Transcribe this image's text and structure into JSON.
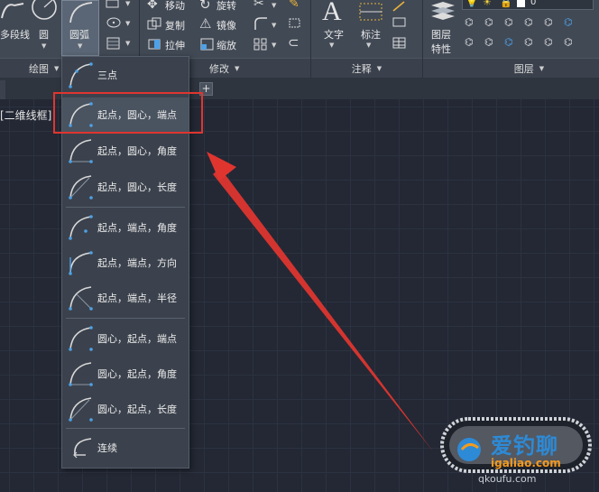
{
  "ribbon": {
    "draw_panel": {
      "title": "绘图",
      "polyline_label": "多段线",
      "circle_label": "圆",
      "arc_label": "圆弧"
    },
    "modify_panel": {
      "title": "修改",
      "move_label": "移动",
      "rotate_label": "旋转",
      "copy_label": "复制",
      "mirror_label": "镜像",
      "stretch_label": "拉伸",
      "scale_label": "缩放"
    },
    "annotation_panel": {
      "title": "注释",
      "text_label": "文字",
      "dimension_label": "标注"
    },
    "layers_panel": {
      "title": "图层",
      "properties_label_1": "图层",
      "properties_label_2": "特性",
      "current_layer": "0"
    }
  },
  "viewport": {
    "label": "[二维线框]"
  },
  "arc_menu": {
    "items": [
      {
        "label": "三点"
      },
      {
        "label": "起点，圆心，端点"
      },
      {
        "label": "起点，圆心，角度"
      },
      {
        "label": "起点，圆心，长度"
      },
      {
        "label": "起点，端点，角度"
      },
      {
        "label": "起点，端点，方向"
      },
      {
        "label": "起点，端点，半径"
      },
      {
        "label": "圆心，起点，端点"
      },
      {
        "label": "圆心，起点，角度"
      },
      {
        "label": "圆心，起点，长度"
      },
      {
        "label": "连续"
      }
    ]
  },
  "watermark": {
    "text": "爱钓聊",
    "url": "igaliao.com",
    "sub": "qkoufu.com"
  },
  "colors": {
    "ribbon_bg": "#414955",
    "canvas_bg": "#232834",
    "highlight": "#e0352f",
    "accent": "#4ea1e6"
  }
}
